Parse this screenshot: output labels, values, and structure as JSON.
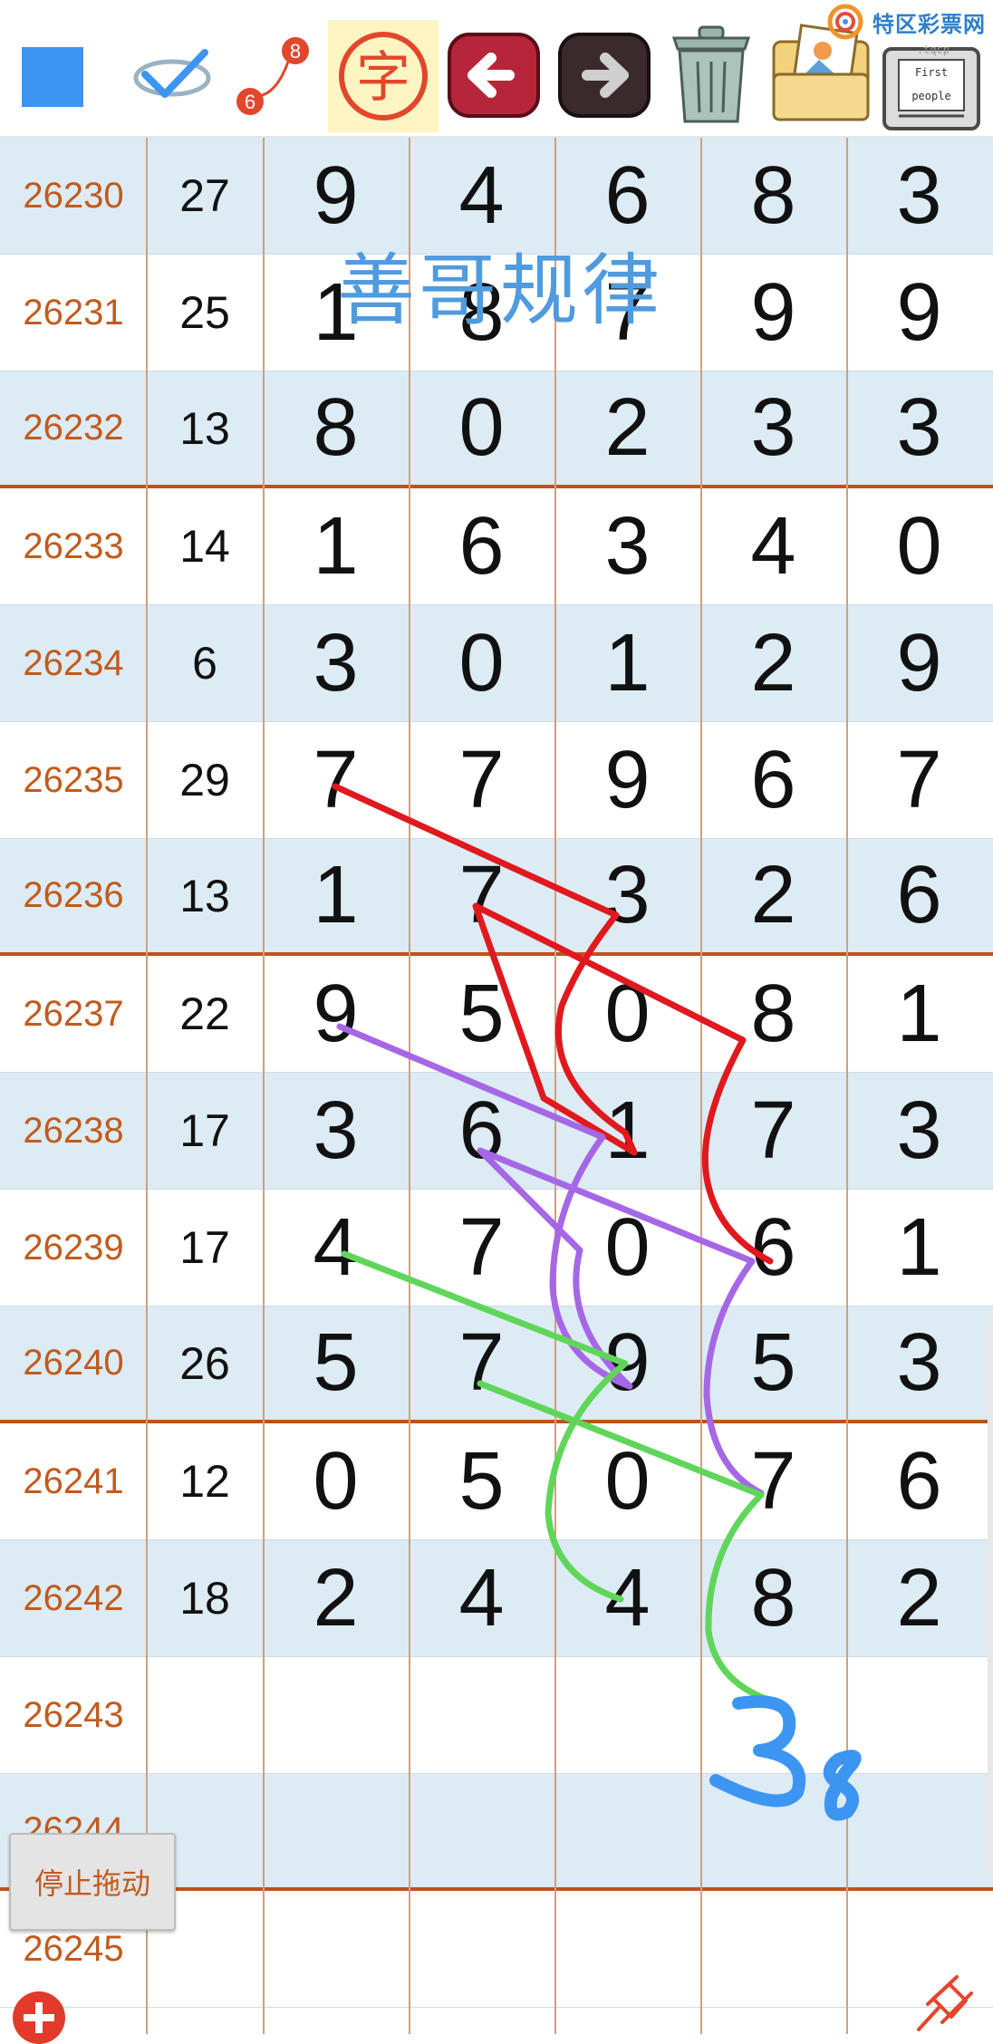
{
  "toolbar": {
    "tools": [
      {
        "name": "color-square-tool",
        "color": "#3d95f2"
      },
      {
        "name": "check-pen-tool"
      },
      {
        "name": "number-tool",
        "label_top": "8",
        "label_bottom": "6"
      },
      {
        "name": "text-tool",
        "label": "字"
      },
      {
        "name": "undo-tool"
      },
      {
        "name": "redo-tool"
      },
      {
        "name": "trash-tool"
      },
      {
        "name": "image-tool"
      },
      {
        "name": "notebook-tool",
        "label_top": "First",
        "label_bottom": "people"
      }
    ],
    "brand": {
      "text": "特区彩票网",
      "sub": ".tqcp"
    }
  },
  "watermark": "善哥规律",
  "rows": [
    {
      "issue": "26230",
      "sum": "27",
      "digits": [
        "9",
        "4",
        "6",
        "8",
        "3"
      ]
    },
    {
      "issue": "26231",
      "sum": "25",
      "digits": [
        "1",
        "8",
        "7",
        "9",
        "9"
      ]
    },
    {
      "issue": "26232",
      "sum": "13",
      "digits": [
        "8",
        "0",
        "2",
        "3",
        "3"
      ]
    },
    {
      "issue": "26233",
      "sum": "14",
      "digits": [
        "1",
        "6",
        "3",
        "4",
        "0"
      ]
    },
    {
      "issue": "26234",
      "sum": "6",
      "digits": [
        "3",
        "0",
        "1",
        "2",
        "9"
      ]
    },
    {
      "issue": "26235",
      "sum": "29",
      "digits": [
        "7",
        "7",
        "9",
        "6",
        "7"
      ]
    },
    {
      "issue": "26236",
      "sum": "13",
      "digits": [
        "1",
        "7",
        "3",
        "2",
        "6"
      ]
    },
    {
      "issue": "26237",
      "sum": "22",
      "digits": [
        "9",
        "5",
        "0",
        "8",
        "1"
      ]
    },
    {
      "issue": "26238",
      "sum": "17",
      "digits": [
        "3",
        "6",
        "1",
        "7",
        "3"
      ]
    },
    {
      "issue": "26239",
      "sum": "17",
      "digits": [
        "4",
        "7",
        "0",
        "6",
        "1"
      ]
    },
    {
      "issue": "26240",
      "sum": "26",
      "digits": [
        "5",
        "7",
        "9",
        "5",
        "3"
      ]
    },
    {
      "issue": "26241",
      "sum": "12",
      "digits": [
        "0",
        "5",
        "0",
        "7",
        "6"
      ]
    },
    {
      "issue": "26242",
      "sum": "18",
      "digits": [
        "2",
        "4",
        "4",
        "8",
        "2"
      ]
    },
    {
      "issue": "26243",
      "sum": "",
      "digits": [
        "",
        "",
        "",
        "",
        ""
      ]
    },
    {
      "issue": "26244",
      "sum": "",
      "digits": [
        "",
        "",
        "",
        "",
        ""
      ]
    },
    {
      "issue": "26245",
      "sum": "",
      "digits": [
        "",
        "",
        "",
        "",
        ""
      ]
    }
  ],
  "handwritten_prediction": "38",
  "stop_drag_label": "停止拖动",
  "colors": {
    "issue": "#c25a1c",
    "row_shade": "#dcebf4",
    "divider": "#c1511c",
    "line_red": "#e0191e",
    "line_purple": "#a667e6",
    "line_green": "#5fd65a",
    "line_blue": "#3d95f2"
  }
}
